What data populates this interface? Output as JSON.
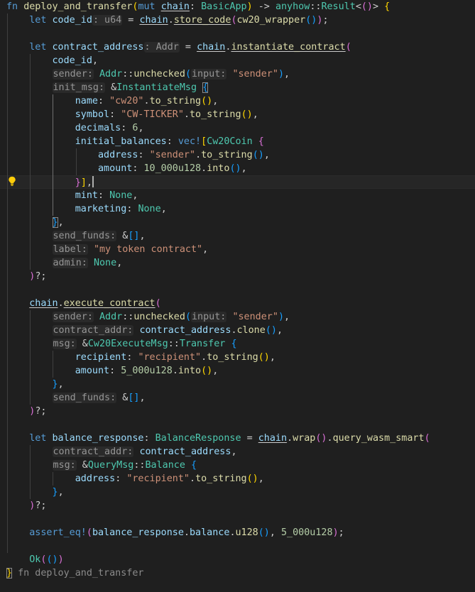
{
  "editor": {
    "language": "rust",
    "lightbulb_icon": "lightbulb-icon",
    "lines": [
      [
        [
          "kw",
          "fn"
        ],
        [
          "pun",
          " "
        ],
        [
          "fn",
          "deploy_and_transfer"
        ],
        [
          "b1",
          "("
        ],
        [
          "kw",
          "mut"
        ],
        [
          "pun",
          " "
        ],
        [
          "var ul",
          "chain"
        ],
        [
          "pun",
          ": "
        ],
        [
          "ty",
          "BasicApp"
        ],
        [
          "b1",
          ")"
        ],
        [
          "pun",
          " -> "
        ],
        [
          "ty",
          "anyhow"
        ],
        [
          "pun",
          "::"
        ],
        [
          "ty",
          "Result"
        ],
        [
          "pun",
          "<"
        ],
        [
          "b2",
          "()"
        ],
        [
          "pun",
          "> "
        ],
        [
          "b1",
          "{"
        ]
      ],
      [
        [
          "pun",
          "    "
        ],
        [
          "kw",
          "let"
        ],
        [
          "pun",
          " "
        ],
        [
          "var",
          "code_id"
        ],
        [
          "hint",
          ": u64"
        ],
        [
          "pun",
          " = "
        ],
        [
          "var ul",
          "chain"
        ],
        [
          "pun",
          "."
        ],
        [
          "fn ul",
          "store_code"
        ],
        [
          "b2",
          "("
        ],
        [
          "fn",
          "cw20_wrapper"
        ],
        [
          "b3",
          "()"
        ],
        [
          "b2",
          ")"
        ],
        [
          "pun",
          ";"
        ]
      ],
      [],
      [
        [
          "pun",
          "    "
        ],
        [
          "kw",
          "let"
        ],
        [
          "pun",
          " "
        ],
        [
          "var",
          "contract_address"
        ],
        [
          "hint",
          ": Addr"
        ],
        [
          "pun",
          " = "
        ],
        [
          "var ul",
          "chain"
        ],
        [
          "pun",
          "."
        ],
        [
          "fn ul",
          "instantiate_contract"
        ],
        [
          "b2",
          "("
        ]
      ],
      [
        [
          "pun",
          "        "
        ],
        [
          "var",
          "code_id"
        ],
        [
          "pun",
          ","
        ]
      ],
      [
        [
          "pun",
          "        "
        ],
        [
          "hint",
          "sender:"
        ],
        [
          "pun",
          " "
        ],
        [
          "ty",
          "Addr"
        ],
        [
          "pun",
          "::"
        ],
        [
          "fn",
          "unchecked"
        ],
        [
          "b3",
          "("
        ],
        [
          "hint",
          "input:"
        ],
        [
          "pun",
          " "
        ],
        [
          "str",
          "\"sender\""
        ],
        [
          "b3",
          ")"
        ],
        [
          "pun",
          ","
        ]
      ],
      [
        [
          "pun",
          "        "
        ],
        [
          "hint",
          "init_msg:"
        ],
        [
          "pun",
          " &"
        ],
        [
          "ty",
          "InstantiateMsg"
        ],
        [
          "pun",
          " "
        ],
        [
          "b3 box",
          "{"
        ]
      ],
      [
        [
          "pun",
          "            "
        ],
        [
          "fld",
          "name"
        ],
        [
          "pun",
          ": "
        ],
        [
          "str",
          "\"cw20\""
        ],
        [
          "pun",
          "."
        ],
        [
          "fn",
          "to_string"
        ],
        [
          "b1",
          "()"
        ],
        [
          "pun",
          ","
        ]
      ],
      [
        [
          "pun",
          "            "
        ],
        [
          "fld",
          "symbol"
        ],
        [
          "pun",
          ": "
        ],
        [
          "str",
          "\"CW-TICKER\""
        ],
        [
          "pun",
          "."
        ],
        [
          "fn",
          "to_string"
        ],
        [
          "b1",
          "()"
        ],
        [
          "pun",
          ","
        ]
      ],
      [
        [
          "pun",
          "            "
        ],
        [
          "fld",
          "decimals"
        ],
        [
          "pun",
          ": "
        ],
        [
          "num",
          "6"
        ],
        [
          "pun",
          ","
        ]
      ],
      [
        [
          "pun",
          "            "
        ],
        [
          "fld",
          "initial_balances"
        ],
        [
          "pun",
          ": "
        ],
        [
          "mac",
          "vec!"
        ],
        [
          "b1",
          "["
        ],
        [
          "ty",
          "Cw20Coin"
        ],
        [
          "pun",
          " "
        ],
        [
          "b2",
          "{"
        ]
      ],
      [
        [
          "pun",
          "                "
        ],
        [
          "fld",
          "address"
        ],
        [
          "pun",
          ": "
        ],
        [
          "str",
          "\"sender\""
        ],
        [
          "pun",
          "."
        ],
        [
          "fn",
          "to_string"
        ],
        [
          "b3",
          "()"
        ],
        [
          "pun",
          ","
        ]
      ],
      [
        [
          "pun",
          "                "
        ],
        [
          "fld",
          "amount"
        ],
        [
          "pun",
          ": "
        ],
        [
          "num",
          "10_000u128"
        ],
        [
          "pun",
          "."
        ],
        [
          "fn",
          "into"
        ],
        [
          "b3",
          "()"
        ],
        [
          "pun",
          ","
        ]
      ],
      [
        [
          "pun",
          "            "
        ],
        [
          "b2",
          "}"
        ],
        [
          "b1",
          "]"
        ],
        [
          "pun",
          ","
        ],
        [
          "caret",
          ""
        ]
      ],
      [
        [
          "pun",
          "            "
        ],
        [
          "fld",
          "mint"
        ],
        [
          "pun",
          ": "
        ],
        [
          "ty",
          "None"
        ],
        [
          "pun",
          ","
        ]
      ],
      [
        [
          "pun",
          "            "
        ],
        [
          "fld",
          "marketing"
        ],
        [
          "pun",
          ": "
        ],
        [
          "ty",
          "None"
        ],
        [
          "pun",
          ","
        ]
      ],
      [
        [
          "pun",
          "        "
        ],
        [
          "b3 box",
          "}"
        ],
        [
          "pun",
          ","
        ]
      ],
      [
        [
          "pun",
          "        "
        ],
        [
          "hint",
          "send_funds:"
        ],
        [
          "pun",
          " &"
        ],
        [
          "b3",
          "[]"
        ],
        [
          "pun",
          ","
        ]
      ],
      [
        [
          "pun",
          "        "
        ],
        [
          "hint",
          "label:"
        ],
        [
          "pun",
          " "
        ],
        [
          "str",
          "\"my token contract\""
        ],
        [
          "pun",
          ","
        ]
      ],
      [
        [
          "pun",
          "        "
        ],
        [
          "hint",
          "admin:"
        ],
        [
          "pun",
          " "
        ],
        [
          "ty",
          "None"
        ],
        [
          "pun",
          ","
        ]
      ],
      [
        [
          "pun",
          "    "
        ],
        [
          "b2",
          ")"
        ],
        [
          "pun",
          "?;"
        ]
      ],
      [],
      [
        [
          "pun",
          "    "
        ],
        [
          "var ul",
          "chain"
        ],
        [
          "pun",
          "."
        ],
        [
          "fn ul",
          "execute_contract"
        ],
        [
          "b2",
          "("
        ]
      ],
      [
        [
          "pun",
          "        "
        ],
        [
          "hint",
          "sender:"
        ],
        [
          "pun",
          " "
        ],
        [
          "ty",
          "Addr"
        ],
        [
          "pun",
          "::"
        ],
        [
          "fn",
          "unchecked"
        ],
        [
          "b3",
          "("
        ],
        [
          "hint",
          "input:"
        ],
        [
          "pun",
          " "
        ],
        [
          "str",
          "\"sender\""
        ],
        [
          "b3",
          ")"
        ],
        [
          "pun",
          ","
        ]
      ],
      [
        [
          "pun",
          "        "
        ],
        [
          "hint",
          "contract_addr:"
        ],
        [
          "pun",
          " "
        ],
        [
          "var",
          "contract_address"
        ],
        [
          "pun",
          "."
        ],
        [
          "fn",
          "clone"
        ],
        [
          "b3",
          "()"
        ],
        [
          "pun",
          ","
        ]
      ],
      [
        [
          "pun",
          "        "
        ],
        [
          "hint",
          "msg:"
        ],
        [
          "pun",
          " &"
        ],
        [
          "ty",
          "Cw20ExecuteMsg"
        ],
        [
          "pun",
          "::"
        ],
        [
          "ty",
          "Transfer"
        ],
        [
          "pun",
          " "
        ],
        [
          "b3",
          "{"
        ]
      ],
      [
        [
          "pun",
          "            "
        ],
        [
          "fld",
          "recipient"
        ],
        [
          "pun",
          ": "
        ],
        [
          "str",
          "\"recipient\""
        ],
        [
          "pun",
          "."
        ],
        [
          "fn",
          "to_string"
        ],
        [
          "b1",
          "()"
        ],
        [
          "pun",
          ","
        ]
      ],
      [
        [
          "pun",
          "            "
        ],
        [
          "fld",
          "amount"
        ],
        [
          "pun",
          ": "
        ],
        [
          "num",
          "5_000u128"
        ],
        [
          "pun",
          "."
        ],
        [
          "fn",
          "into"
        ],
        [
          "b1",
          "()"
        ],
        [
          "pun",
          ","
        ]
      ],
      [
        [
          "pun",
          "        "
        ],
        [
          "b3",
          "}"
        ],
        [
          "pun",
          ","
        ]
      ],
      [
        [
          "pun",
          "        "
        ],
        [
          "hint",
          "send_funds:"
        ],
        [
          "pun",
          " &"
        ],
        [
          "b3",
          "[]"
        ],
        [
          "pun",
          ","
        ]
      ],
      [
        [
          "pun",
          "    "
        ],
        [
          "b2",
          ")"
        ],
        [
          "pun",
          "?;"
        ]
      ],
      [],
      [
        [
          "pun",
          "    "
        ],
        [
          "kw",
          "let"
        ],
        [
          "pun",
          " "
        ],
        [
          "var",
          "balance_response"
        ],
        [
          "pun",
          ": "
        ],
        [
          "ty",
          "BalanceResponse"
        ],
        [
          "pun",
          " = "
        ],
        [
          "var ul",
          "chain"
        ],
        [
          "pun",
          "."
        ],
        [
          "fn",
          "wrap"
        ],
        [
          "b2",
          "()"
        ],
        [
          "pun",
          "."
        ],
        [
          "fn",
          "query_wasm_smart"
        ],
        [
          "b2",
          "("
        ]
      ],
      [
        [
          "pun",
          "        "
        ],
        [
          "hint",
          "contract_addr:"
        ],
        [
          "pun",
          " "
        ],
        [
          "var",
          "contract_address"
        ],
        [
          "pun",
          ","
        ]
      ],
      [
        [
          "pun",
          "        "
        ],
        [
          "hint",
          "msg:"
        ],
        [
          "pun",
          " &"
        ],
        [
          "ty",
          "QueryMsg"
        ],
        [
          "pun",
          "::"
        ],
        [
          "ty",
          "Balance"
        ],
        [
          "pun",
          " "
        ],
        [
          "b3",
          "{"
        ]
      ],
      [
        [
          "pun",
          "            "
        ],
        [
          "fld",
          "address"
        ],
        [
          "pun",
          ": "
        ],
        [
          "str",
          "\"recipient\""
        ],
        [
          "pun",
          "."
        ],
        [
          "fn",
          "to_string"
        ],
        [
          "b1",
          "()"
        ],
        [
          "pun",
          ","
        ]
      ],
      [
        [
          "pun",
          "        "
        ],
        [
          "b3",
          "}"
        ],
        [
          "pun",
          ","
        ]
      ],
      [
        [
          "pun",
          "    "
        ],
        [
          "b2",
          ")"
        ],
        [
          "pun",
          "?;"
        ]
      ],
      [],
      [
        [
          "pun",
          "    "
        ],
        [
          "mac",
          "assert_eq!"
        ],
        [
          "b2",
          "("
        ],
        [
          "var",
          "balance_response"
        ],
        [
          "pun",
          "."
        ],
        [
          "fld",
          "balance"
        ],
        [
          "pun",
          "."
        ],
        [
          "fn",
          "u128"
        ],
        [
          "b3",
          "()"
        ],
        [
          "pun",
          ", "
        ],
        [
          "num",
          "5_000u128"
        ],
        [
          "b2",
          ")"
        ],
        [
          "pun",
          ";"
        ]
      ],
      [],
      [
        [
          "pun",
          "    "
        ],
        [
          "ty",
          "Ok"
        ],
        [
          "b2",
          "("
        ],
        [
          "b3",
          "()"
        ],
        [
          "b2",
          ")"
        ]
      ],
      [
        [
          "b1 box",
          "}"
        ],
        [
          "fold-hint",
          " fn deploy_and_transfer"
        ]
      ]
    ]
  }
}
